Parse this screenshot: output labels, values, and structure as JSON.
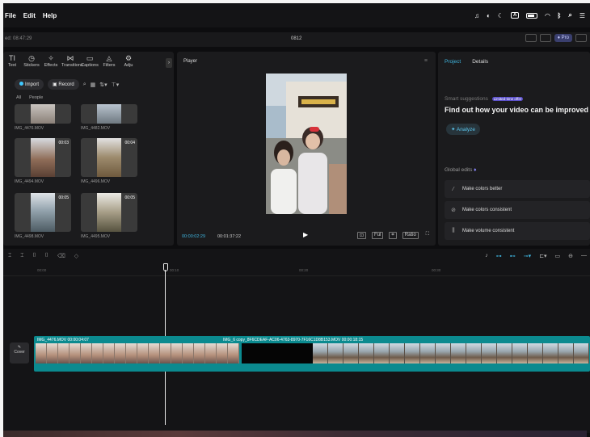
{
  "menubar": {
    "items": [
      "File",
      "Edit",
      "Help"
    ],
    "status_icons": [
      "sound-icon",
      "focus-icon",
      "moon-icon",
      "keyboard-icon",
      "battery-icon",
      "wifi-icon",
      "bluetooth-icon",
      "search-icon",
      "control-center-icon"
    ]
  },
  "titlebar": {
    "autosave": "ed: 08:47:29",
    "project_name": "0812",
    "pro_label": "Pro"
  },
  "media": {
    "tools": [
      {
        "icon": "text-icon",
        "label": "Text"
      },
      {
        "icon": "stickers-icon",
        "label": "Stickers"
      },
      {
        "icon": "effects-icon",
        "label": "Effects"
      },
      {
        "icon": "transitions-icon",
        "label": "Transitions"
      },
      {
        "icon": "captions-icon",
        "label": "Captions"
      },
      {
        "icon": "filters-icon",
        "label": "Filters"
      },
      {
        "icon": "adjust-icon",
        "label": "Adju"
      }
    ],
    "import_label": "Import",
    "record_label": "Record",
    "filter_tabs": [
      "All",
      "People"
    ],
    "clips": [
      {
        "name": "IMG_4476.MOV",
        "duration": ""
      },
      {
        "name": "IMG_4482.MOV",
        "duration": ""
      },
      {
        "name": "IMG_4494.MOV",
        "duration": "00:03"
      },
      {
        "name": "IMG_4496.MOV",
        "duration": "00:04"
      },
      {
        "name": "IMG_4498.MOV",
        "duration": "00:05"
      },
      {
        "name": "IMG_4495.MOV",
        "duration": "00:05"
      }
    ]
  },
  "player": {
    "title": "Player",
    "current_time": "00:00:02:29",
    "total_time": "00:01:37:22"
  },
  "side": {
    "tab_project": "Project",
    "tab_details": "Details",
    "suggestions_label": "Smart suggestions",
    "new_badge": "Limited-time offer",
    "headline": "Find out how your video can be improved",
    "analyze_label": "Analyze",
    "global_edits_label": "Global edits",
    "edits": [
      {
        "icon": "magic-wand-icon",
        "label": "Make colors better"
      },
      {
        "icon": "palette-icon",
        "label": "Make colors consistent"
      },
      {
        "icon": "volume-icon",
        "label": "Make volume consistent"
      }
    ]
  },
  "timeline": {
    "ruler": [
      "00:00",
      "00:10",
      "00:20",
      "00:30"
    ],
    "cover_label": "Cover",
    "clip1_label": "IMG_4476.MOV  00:00:04:07",
    "clip2_label": "IMG_6  copy_8F6CDEAF-AC06-4763-8970-7F16C1D8B153.MOV  00:00:18:15"
  }
}
